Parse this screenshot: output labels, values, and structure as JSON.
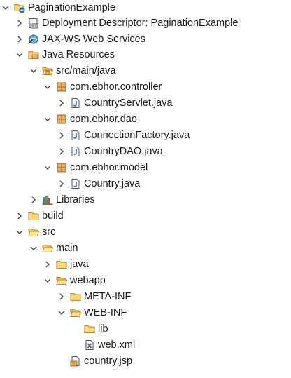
{
  "tree": {
    "project": "PaginationExample",
    "deployment_descriptor": "Deployment Descriptor: PaginationExample",
    "jaxws": "JAX-WS Web Services",
    "java_resources": "Java Resources",
    "src_main_java": "src/main/java",
    "pkg_controller": "com.ebhor.controller",
    "country_servlet": "CountryServlet.java",
    "pkg_dao": "com.ebhor.dao",
    "connection_factory": "ConnectionFactory.java",
    "country_dao": "CountryDAO.java",
    "pkg_model": "com.ebhor.model",
    "country_java": "Country.java",
    "libraries": "Libraries",
    "build": "build",
    "src": "src",
    "main": "main",
    "java": "java",
    "webapp": "webapp",
    "meta_inf": "META-INF",
    "web_inf": "WEB-INF",
    "lib": "lib",
    "web_xml": "web.xml",
    "country_jsp": "country.jsp"
  }
}
